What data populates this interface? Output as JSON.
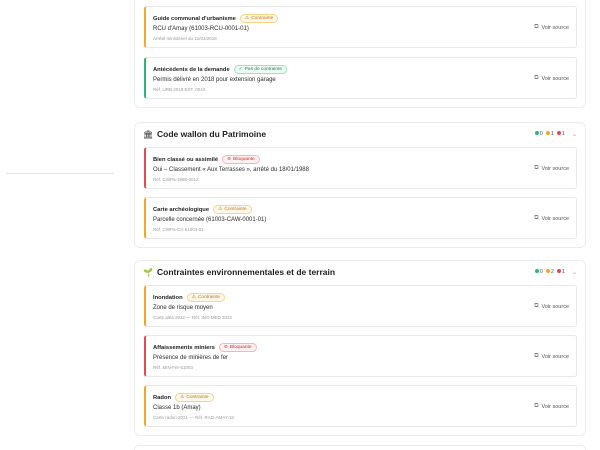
{
  "groups": [
    {
      "title": "",
      "cards": [
        {
          "title": "Guide communal d'urbanisme",
          "badge": "Contrainte",
          "value": "RCU d'Amay (61003-RCU-0001-01)",
          "ref": "Arrêté ministériel du 12/03/2018",
          "link": "Voir source"
        },
        {
          "title": "Antécédents de la demande",
          "badge": "Pas de contrainte",
          "value": "Permis délivré en 2018 pour extension garage",
          "ref": "Réf. URB 2018 EXT. 0043",
          "link": "Voir source"
        }
      ]
    },
    {
      "title": "Code wallon du Patrimoine",
      "icon": "🏛",
      "counts": [
        "0",
        "1",
        "1"
      ],
      "cards": [
        {
          "title": "Bien classé ou assimilé",
          "badge": "Bloquante",
          "value": "Oui – Classement « Aux Terrasses », arrêté du 18/01/1988",
          "ref": "Réf. CWPa-1988-0012",
          "link": "Voir source"
        },
        {
          "title": "Carte archéologique",
          "badge": "Contrainte",
          "value": "Parcelle concernée (61003-CAW-0001-01)",
          "ref": "Réf. CWPa-CA-61003-01",
          "link": "Voir source"
        }
      ]
    },
    {
      "title": "Contraintes environnementales et de terrain",
      "icon": "🌱",
      "counts": [
        "0",
        "2",
        "1"
      ],
      "cards": [
        {
          "title": "Inondation",
          "badge": "Contrainte",
          "value": "Zone de risque moyen",
          "ref": "Carte aléa 2022 — Réf. INO MED 2022",
          "link": "Voir source"
        },
        {
          "title": "Affaissements miniers",
          "badge": "Bloquante",
          "value": "Présence de minières de fer",
          "ref": "Réf. MIN-Fer-61003",
          "link": "Voir source"
        },
        {
          "title": "Radon",
          "badge": "Contrainte",
          "value": "Classe 1b (Amay)",
          "ref": "Carte radon 2021 — Réf. RAD-AMAY-1b",
          "link": "Voir source"
        }
      ]
    }
  ],
  "colors": {
    "orange": "#f5a623",
    "green": "#2bb673",
    "red": "#e5484d"
  }
}
